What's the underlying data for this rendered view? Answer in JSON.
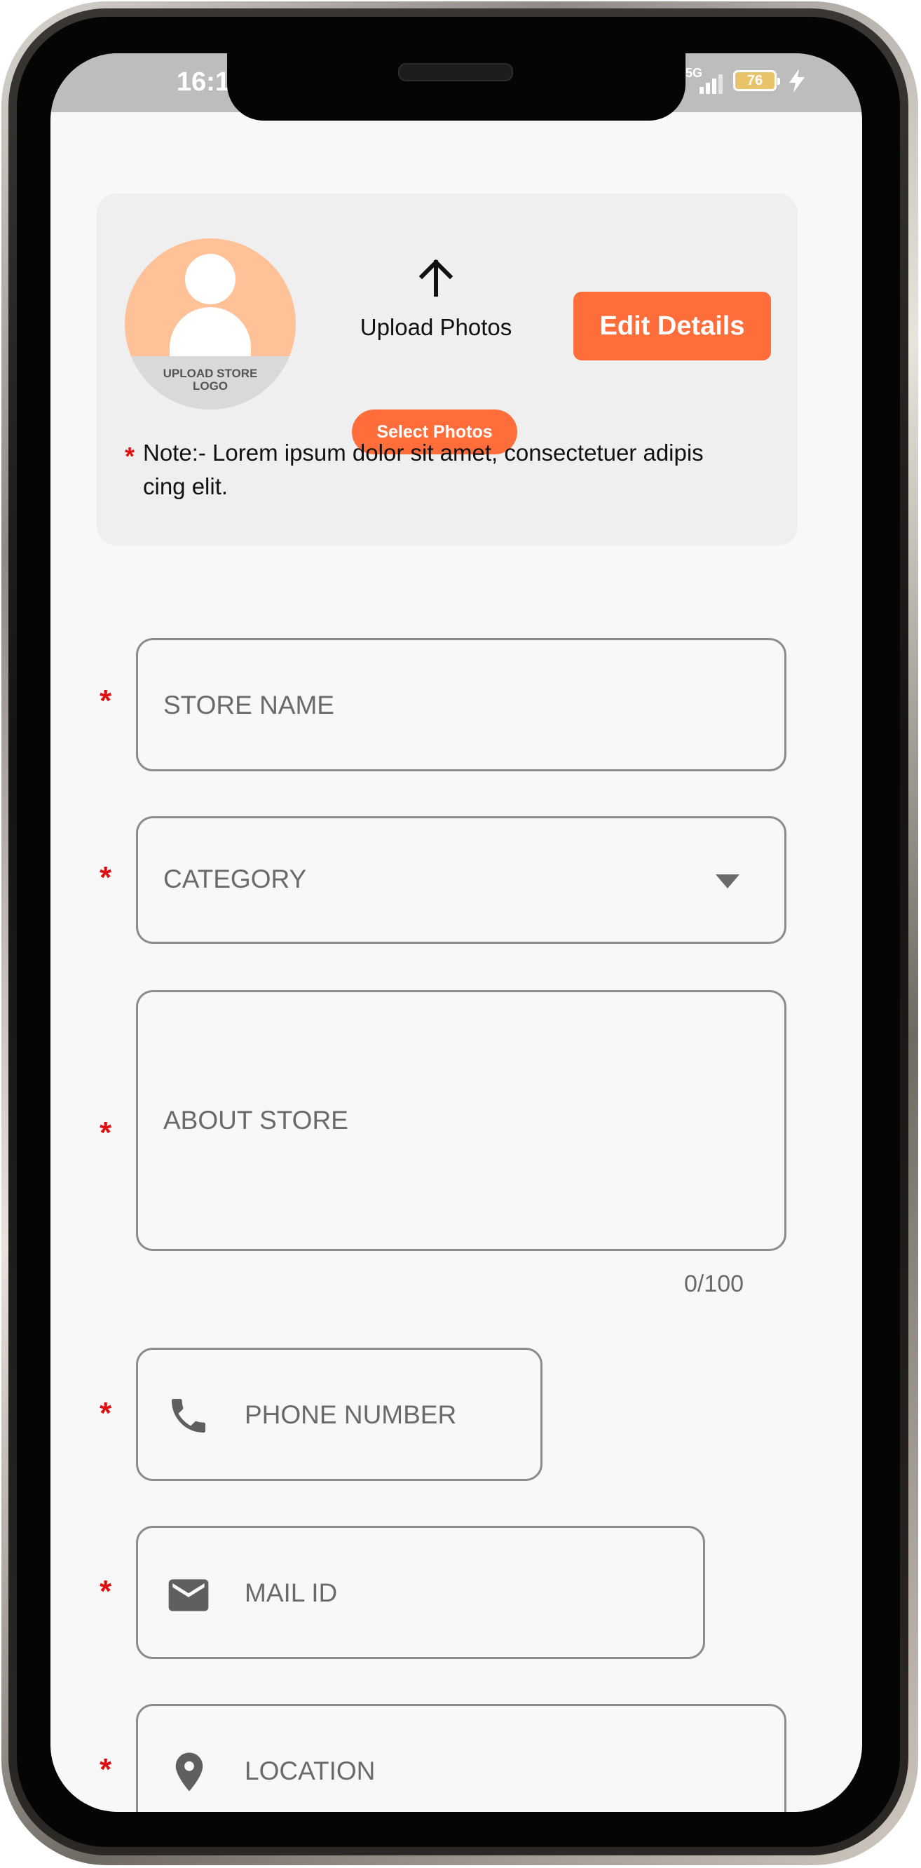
{
  "status_bar": {
    "time": "16:1",
    "network": "5G",
    "battery": "76"
  },
  "upload_card": {
    "logo_label": "UPLOAD STORE LOGO",
    "upload_title": "Upload Photos",
    "select_photos_label": "Select Photos",
    "edit_details_label": "Edit Details",
    "note": "Note:- Lorem ipsum dolor sit amet, consectetuer adipis cing elit."
  },
  "form": {
    "required_mark": "*",
    "store_name": {
      "placeholder": "STORE NAME"
    },
    "category": {
      "placeholder": "CATEGORY"
    },
    "about_store": {
      "placeholder": "ABOUT STORE",
      "counter": "0/100"
    },
    "phone_number": {
      "placeholder": "PHONE NUMBER"
    },
    "mail_id": {
      "placeholder": "MAIL ID"
    },
    "location": {
      "placeholder": "LOCATION"
    }
  },
  "icons": {
    "avatar": "person-placeholder-icon",
    "upload": "arrow-up-icon",
    "dropdown": "caret-down-icon",
    "phone": "phone-icon",
    "mail": "envelope-icon",
    "location": "map-pin-icon"
  },
  "colors": {
    "accent": "#ff6d3a",
    "required": "#e01010",
    "avatar_bg": "#ffc198",
    "card_bg": "#efefef",
    "field_border": "#8c8c8c",
    "placeholder_text": "#6a6a6a",
    "screen_bg": "#f8f8f8"
  }
}
